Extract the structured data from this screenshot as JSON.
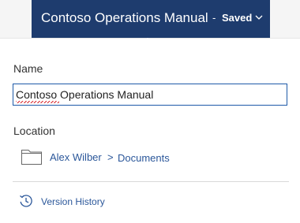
{
  "header": {
    "document_title": "Contoso Operations Manual",
    "separator": "-",
    "save_status": "Saved",
    "dropdown_icon": "chevron-down-icon",
    "colors": {
      "title_bar": "#1e3c6e",
      "page_strip": "#f5f5f5"
    }
  },
  "details": {
    "name_label": "Name",
    "name_value": "Contoso Operations Manual",
    "location_label": "Location",
    "location": {
      "icon": "folder-icon",
      "user": "Alex Wilber",
      "separator": ">",
      "folder": "Documents"
    },
    "version_history": {
      "icon": "history-icon",
      "label": "Version History"
    },
    "colors": {
      "link": "#2b579a",
      "input_border": "#1e5aa8",
      "spellcheck": "#d9282f"
    }
  }
}
